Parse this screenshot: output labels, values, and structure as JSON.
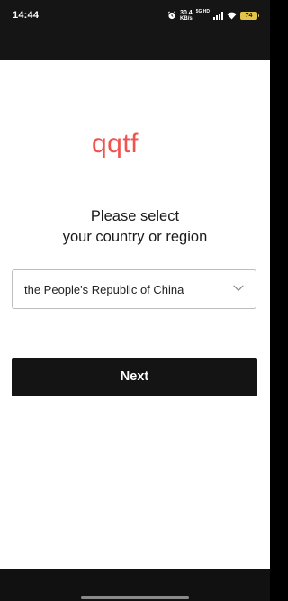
{
  "status_bar": {
    "time": "14:44",
    "net_speed_value": "30.4",
    "net_speed_unit": "KB/s",
    "network_type": "5G HD",
    "battery_level": "74",
    "icons": [
      "alarm-icon",
      "signal-icon",
      "wifi-icon",
      "battery-icon"
    ]
  },
  "app": {
    "logo_text": "qqtf",
    "logo_color": "#ef5350"
  },
  "prompt": {
    "line1": "Please select",
    "line2": "your country or region"
  },
  "country_select": {
    "selected_value": "the People's Republic of China",
    "icon": "chevron-down-icon"
  },
  "actions": {
    "next_label": "Next"
  },
  "colors": {
    "button_bg": "#141414",
    "status_bar_bg": "#151515",
    "battery": "#e3c44b"
  }
}
